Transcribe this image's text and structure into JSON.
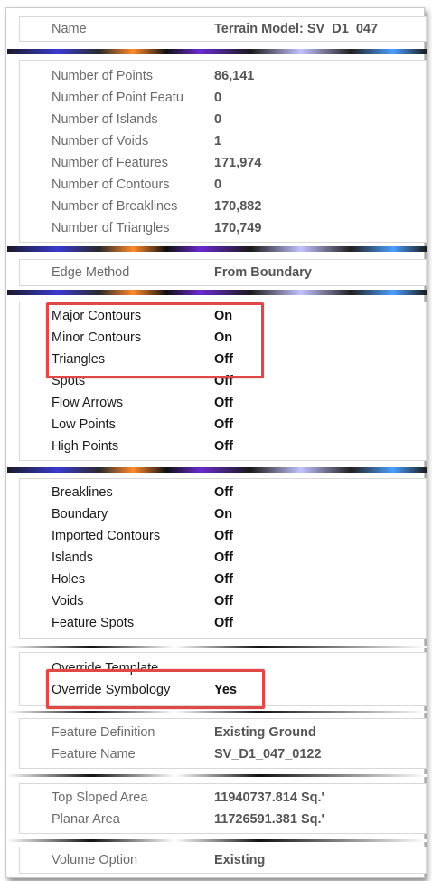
{
  "header": {
    "label": "Name",
    "value": "Terrain Model: SV_D1_047"
  },
  "stats": [
    {
      "label": "Number of Points",
      "value": "86,141"
    },
    {
      "label": "Number of Point Featu",
      "value": "0"
    },
    {
      "label": "Number of Islands",
      "value": "0"
    },
    {
      "label": "Number of Voids",
      "value": "1"
    },
    {
      "label": "Number of Features",
      "value": "171,974"
    },
    {
      "label": "Number of Contours",
      "value": "0"
    },
    {
      "label": "Number of Breaklines",
      "value": "170,882"
    },
    {
      "label": "Number of Triangles",
      "value": "170,749"
    }
  ],
  "edge": {
    "label": "Edge Method",
    "value": "From Boundary"
  },
  "display": [
    {
      "label": "Major Contours",
      "value": "On"
    },
    {
      "label": "Minor Contours",
      "value": "On"
    },
    {
      "label": "Triangles",
      "value": "Off"
    },
    {
      "label": "Spots",
      "value": "Off"
    },
    {
      "label": "Flow Arrows",
      "value": "Off"
    },
    {
      "label": "Low Points",
      "value": "Off"
    },
    {
      "label": "High Points",
      "value": "Off"
    }
  ],
  "features": [
    {
      "label": "Breaklines",
      "value": "Off"
    },
    {
      "label": "Boundary",
      "value": "On"
    },
    {
      "label": "Imported Contours",
      "value": "Off"
    },
    {
      "label": "Islands",
      "value": "Off"
    },
    {
      "label": "Holes",
      "value": "Off"
    },
    {
      "label": "Voids",
      "value": "Off"
    },
    {
      "label": "Feature Spots",
      "value": "Off"
    }
  ],
  "override": [
    {
      "label": "Override Template",
      "value": ""
    },
    {
      "label": "Override Symbology",
      "value": "Yes"
    }
  ],
  "definition": [
    {
      "label": "Feature Definition",
      "value": "Existing Ground"
    },
    {
      "label": "Feature Name",
      "value": "SV_D1_047_0122"
    }
  ],
  "area": [
    {
      "label": "Top Sloped Area",
      "value": "11940737.814 Sq.'"
    },
    {
      "label": "Planar Area",
      "value": "11726591.381 Sq.'"
    }
  ],
  "volume": {
    "label": "Volume Option",
    "value": "Existing"
  },
  "colors": {
    "highlight": "#e04848",
    "label_gray": "#6b6b6b"
  }
}
